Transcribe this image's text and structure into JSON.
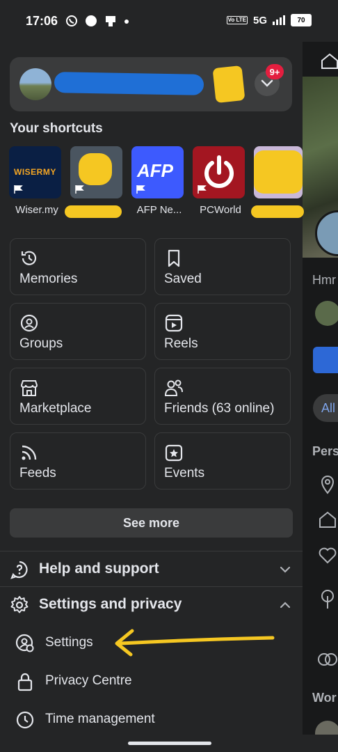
{
  "status_bar": {
    "time": "17:06",
    "network": "5G",
    "volte": "Vo LTE",
    "battery": "70"
  },
  "profile": {
    "notification_badge": "9+"
  },
  "shortcuts": {
    "title": "Your shortcuts",
    "items": [
      {
        "label": "Wiser.my",
        "tile_text": "WISERMY",
        "color": "#0a1f44"
      },
      {
        "label": "",
        "tile_text": "",
        "color": "#4a5560"
      },
      {
        "label": "AFP Ne...",
        "tile_text": "AFP",
        "color": "#3d5afe"
      },
      {
        "label": "PCWorld",
        "tile_text": "",
        "color": "#a31621"
      },
      {
        "label": "",
        "tile_text": "",
        "color": "#c9b8d8"
      }
    ]
  },
  "menu_grid": [
    {
      "label": "Memories",
      "icon": "clock-history-icon"
    },
    {
      "label": "Saved",
      "icon": "bookmark-icon"
    },
    {
      "label": "Groups",
      "icon": "groups-icon"
    },
    {
      "label": "Reels",
      "icon": "reels-icon"
    },
    {
      "label": "Marketplace",
      "icon": "store-icon"
    },
    {
      "label": "Friends (63 online)",
      "icon": "friends-icon"
    },
    {
      "label": "Feeds",
      "icon": "feeds-icon"
    },
    {
      "label": "Events",
      "icon": "events-icon"
    }
  ],
  "see_more": "See more",
  "help": {
    "label": "Help and support"
  },
  "settings_privacy": {
    "label": "Settings and privacy",
    "items": [
      {
        "label": "Settings",
        "icon": "settings-user-icon"
      },
      {
        "label": "Privacy Centre",
        "icon": "lock-icon"
      },
      {
        "label": "Time management",
        "icon": "clock-icon"
      }
    ]
  },
  "right_panel": {
    "text_1": "Hmr",
    "pill": "All",
    "text_2": "Pers",
    "text_3": "Wor"
  },
  "colors": {
    "background": "#242526",
    "card": "#3a3b3c",
    "text": "#e4e6eb",
    "badge": "#e41e3f",
    "annotation_arrow": "#f5c722"
  }
}
